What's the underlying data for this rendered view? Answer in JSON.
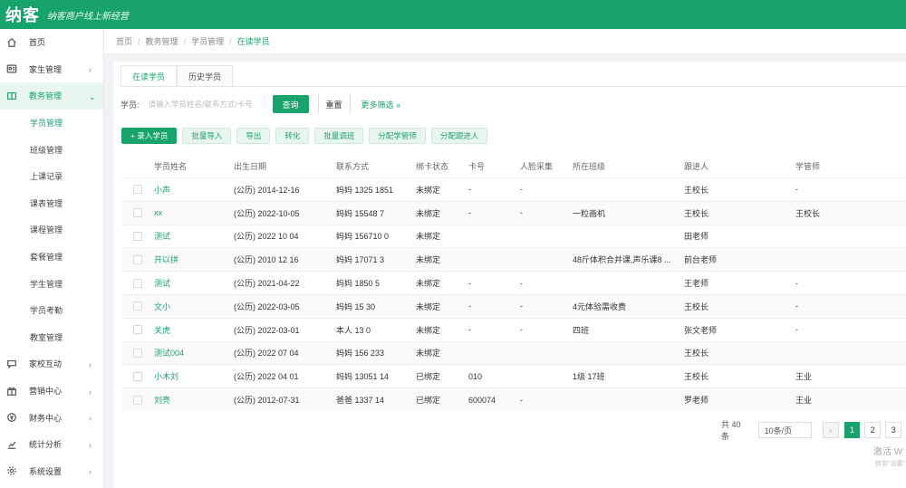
{
  "header": {
    "logo": "纳客",
    "slogan": "纳客商户线上新经营"
  },
  "sidebar": {
    "items": [
      {
        "label": "首页",
        "icon": "home-icon",
        "chevron": ""
      },
      {
        "label": "家生管理",
        "icon": "user-card-icon",
        "chevron": "›"
      },
      {
        "label": "教务管理",
        "icon": "book-icon",
        "chevron": "⌄",
        "open": true
      },
      {
        "label": "学员管理",
        "sub": true,
        "active": true
      },
      {
        "label": "班级管理",
        "sub": true
      },
      {
        "label": "上课记录",
        "sub": true
      },
      {
        "label": "课表管理",
        "sub": true
      },
      {
        "label": "课程管理",
        "sub": true
      },
      {
        "label": "套餐管理",
        "sub": true
      },
      {
        "label": "学生管理",
        "sub": true
      },
      {
        "label": "学员考勤",
        "sub": true
      },
      {
        "label": "教室管理",
        "sub": true
      },
      {
        "label": "家校互动",
        "icon": "chat-icon",
        "chevron": "›"
      },
      {
        "label": "营销中心",
        "icon": "gift-icon",
        "chevron": "›"
      },
      {
        "label": "财务中心",
        "icon": "money-icon",
        "chevron": "›"
      },
      {
        "label": "统计分析",
        "icon": "chart-icon",
        "chevron": "›"
      },
      {
        "label": "系统设置",
        "icon": "gear-icon",
        "chevron": "›"
      }
    ]
  },
  "breadcrumb": [
    "首页",
    "教务管理",
    "学员管理",
    "在读学员"
  ],
  "tabs": [
    "在读学员",
    "历史学员"
  ],
  "filter": {
    "label": "学员:",
    "placeholder": "请输入学员姓名/联系方式/卡号",
    "query": "查询",
    "reset": "重置",
    "more": "更多筛选 »"
  },
  "actions": [
    "+ 录入学员",
    "批量导入",
    "导出",
    "转化",
    "批量调班",
    "分配学管师",
    "分配跟进人"
  ],
  "table": {
    "headers": [
      "学员姓名",
      "出生日期",
      "联系方式",
      "绑卡状态",
      "卡号",
      "人脸采集",
      "所在班级",
      "跟进人",
      "学管师"
    ],
    "rows": [
      [
        "小声",
        "(公历) 2014-12-16",
        "妈妈 1325 1851",
        "未绑定",
        "-",
        "-",
        "",
        "王校长",
        "-"
      ],
      [
        "xx",
        "(公历) 2022-10-05",
        "妈妈 15548 7",
        "未绑定",
        "-",
        "-",
        "一粒画机",
        "王校长",
        "王校长"
      ],
      [
        "测试",
        "(公历) 2022 10 04",
        "妈妈 156710 0",
        "未绑定",
        "",
        "",
        "",
        "田老师",
        ""
      ],
      [
        "开以拼",
        "(公历) 2010 12 16",
        "妈妈 17071 3",
        "未绑定",
        "",
        "",
        "48斤体积合并课,声乐课8 ...",
        "前台老师",
        ""
      ],
      [
        "测试",
        "(公历) 2021-04-22",
        "妈妈 1850 5",
        "未绑定",
        "-",
        "-",
        "",
        "王老师",
        "-"
      ],
      [
        "文小",
        "(公历) 2022-03-05",
        "妈妈 15 30",
        "未绑定",
        "-",
        "-",
        "4元体验需收费",
        "王校长",
        "-"
      ],
      [
        "关虎",
        "(公历) 2022-03-01",
        "本人 13 0",
        "未绑定",
        "-",
        "-",
        "四班",
        "张文老师",
        "-"
      ],
      [
        "测试004",
        "(公历) 2022 07 04",
        "妈妈 156 233",
        "未绑定",
        "",
        "",
        "",
        "王校长",
        ""
      ],
      [
        "小木刘",
        "(公历) 2022 04 01",
        "妈妈 13051 14",
        "已绑定",
        "010",
        "",
        "1级 17班",
        "王校长",
        "王业"
      ],
      [
        "刘亮",
        "(公历) 2012-07-31",
        "爸爸 1337 14",
        "已绑定",
        "600074",
        "-",
        "",
        "罗老师",
        "王业"
      ]
    ]
  },
  "pagination": {
    "total": "共 40 条",
    "page_size": "10条/页",
    "prev": "‹",
    "pages": [
      "1",
      "2",
      "3"
    ]
  },
  "watermark": {
    "line1": "激活 W",
    "line2": "转到\"设置\""
  },
  "colors": {
    "brand": "#18a36b"
  }
}
